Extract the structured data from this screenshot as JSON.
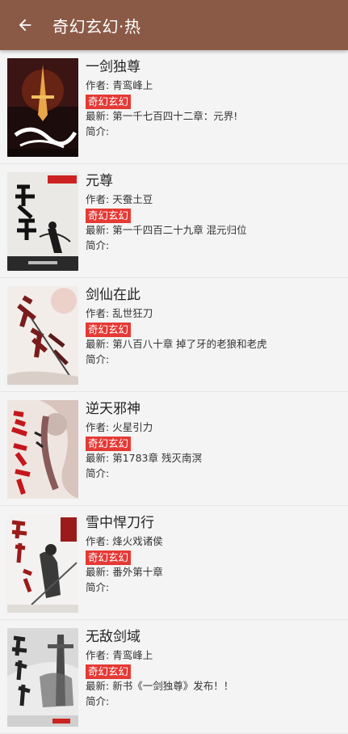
{
  "header": {
    "title": "奇幻玄幻·热"
  },
  "labels": {
    "author": "作者: ",
    "latest": "最新: ",
    "intro": "简介:"
  },
  "books": [
    {
      "title": "一剑独尊",
      "author": "青鸾峰上",
      "genre": "奇幻玄幻",
      "latest": "第一千七百四十二章：元界!",
      "cover": {
        "bg": "#2a1010",
        "accent": "#e8a54a",
        "text": "一剑独尊"
      }
    },
    {
      "title": "元尊",
      "author": "天蚕土豆",
      "genre": "奇幻玄幻",
      "latest": "第一千四百二十九章  混元归位",
      "cover": {
        "bg": "#e9e7e4",
        "accent": "#1a1a1a",
        "text": "元尊"
      }
    },
    {
      "title": "剑仙在此",
      "author": "乱世狂刀",
      "genre": "奇幻玄幻",
      "latest": "第八百八十章 掉了牙的老狼和老虎",
      "cover": {
        "bg": "#f1ece8",
        "accent": "#7a1c1c",
        "text": "剑仙在此"
      }
    },
    {
      "title": "逆天邪神",
      "author": "火星引力",
      "genre": "奇幻玄幻",
      "latest": "第1783章 残灭南溟",
      "cover": {
        "bg": "#efe6e2",
        "accent": "#c4161c",
        "text": "逆天邪神"
      }
    },
    {
      "title": "雪中悍刀行",
      "author": "烽火戏诸侯",
      "genre": "奇幻玄幻",
      "latest": "番外第十章",
      "cover": {
        "bg": "#f3f1ef",
        "accent": "#9b1b1b",
        "text": "雪中悍刀行"
      }
    },
    {
      "title": "无敌剑域",
      "author": "青鸾峰上",
      "genre": "奇幻玄幻",
      "latest": "新书《一剑独尊》发布！！",
      "cover": {
        "bg": "#e9e9e9",
        "accent": "#222222",
        "text": "无敌剑域"
      }
    }
  ]
}
